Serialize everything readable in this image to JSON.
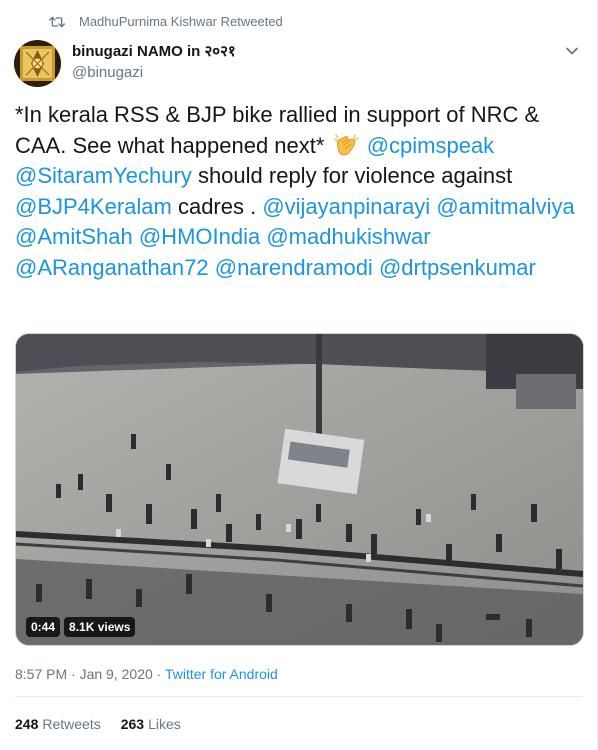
{
  "retweet": {
    "label": "MadhuPurnima Kishwar Retweeted",
    "icon": "retweet-icon"
  },
  "author": {
    "display_name": "binugazi NAMO in २०२१",
    "handle": "@binugazi"
  },
  "tweet": {
    "segments": [
      {
        "type": "text",
        "text": "*In kerala RSS & BJP bike rallied in support of NRC & CAA. See what happened next* "
      },
      {
        "type": "emoji",
        "name": "clapping-hands-icon"
      },
      {
        "type": "text",
        "text": " "
      },
      {
        "type": "mention",
        "text": "@cpimspeak"
      },
      {
        "type": "text",
        "text": " "
      },
      {
        "type": "mention",
        "text": "@SitaramYechury"
      },
      {
        "type": "text",
        "text": " should reply for violence against "
      },
      {
        "type": "mention",
        "text": "@BJP4Keralam"
      },
      {
        "type": "text",
        "text": " cadres . "
      },
      {
        "type": "mention",
        "text": "@vijayanpinarayi"
      },
      {
        "type": "text",
        "text": " "
      },
      {
        "type": "mention",
        "text": "@amitmalviya"
      },
      {
        "type": "text",
        "text": " "
      },
      {
        "type": "mention",
        "text": "@AmitShah"
      },
      {
        "type": "text",
        "text": " "
      },
      {
        "type": "mention",
        "text": "@HMOIndia"
      },
      {
        "type": "text",
        "text": " "
      },
      {
        "type": "mention",
        "text": "@madhukishwar"
      },
      {
        "type": "text",
        "text": " "
      },
      {
        "type": "mention",
        "text": "@ARanganathan72"
      },
      {
        "type": "text",
        "text": " "
      },
      {
        "type": "mention",
        "text": "@narendramodi"
      },
      {
        "type": "text",
        "text": " "
      },
      {
        "type": "mention",
        "text": "@drtpsenkumar"
      }
    ]
  },
  "media": {
    "duration": "0:44",
    "views": "8.1K views"
  },
  "meta": {
    "time": "8:57 PM",
    "separator": " · ",
    "date": "Jan 9, 2020",
    "source": "Twitter for Android"
  },
  "stats": {
    "retweets_count": "248",
    "retweets_label": "Retweets",
    "likes_count": "263",
    "likes_label": "Likes"
  },
  "colors": {
    "accent": "#1b95e0",
    "secondary_text": "#657786",
    "primary_text": "#14171a"
  }
}
